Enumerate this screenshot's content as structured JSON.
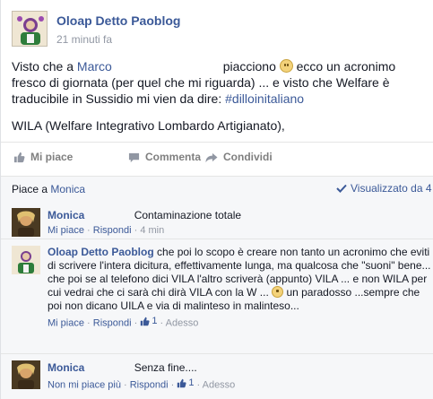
{
  "post": {
    "author": "Oloap Detto Paoblog",
    "time": "21 minuti fa",
    "text": {
      "p1_a": "Visto che a ",
      "p1_link": "Marco",
      "p1_b": " piacciono ",
      "p1_c": " ecco un acronimo fresco di giornata (per quel che mi riguarda) ... e visto che Welfare è traducibile in Sussidio mi vien da dire: ",
      "hashtag": "#dilloinitaliano",
      "p2": "WILA (Welfare Integrativo Lombardo Artigianato),"
    }
  },
  "actions": {
    "like": "Mi piace",
    "comment": "Commenta",
    "share": "Condividi"
  },
  "likes": {
    "prefix": "Piace a ",
    "name": "Monica",
    "seen": "Visualizzato da 4"
  },
  "comments": [
    {
      "author": "Monica",
      "text": "Contaminazione totale",
      "like": "Mi piace",
      "reply": "Rispondi",
      "time": "4 min"
    },
    {
      "author": "Oloap Detto Paoblog",
      "text_a": "che poi lo scopo è creare non tanto un acronimo che eviti di scrivere l'intera dicitura, effettivamente lunga, ma qualcosa che \"suoni\" bene... che poi se al telefono dici VILA l'altro scriverà (appunto) VILA ... e non WILA per cui vedrai che ci sarà chi dirà VILA con la W ... ",
      "text_b": " un paradosso ...sempre che poi non dicano UILA e via di malinteso in malinteso...",
      "like": "Mi piace",
      "reply": "Rispondi",
      "likes_count": "1",
      "time": "Adesso"
    },
    {
      "author": "Monica",
      "text": "Senza fine....",
      "like": "Non mi piace più",
      "reply": "Rispondi",
      "likes_count": "1",
      "time": "Adesso"
    }
  ],
  "colors": {
    "link": "#3b5998",
    "muted": "#9197a3",
    "background": "#f6f7f9"
  }
}
